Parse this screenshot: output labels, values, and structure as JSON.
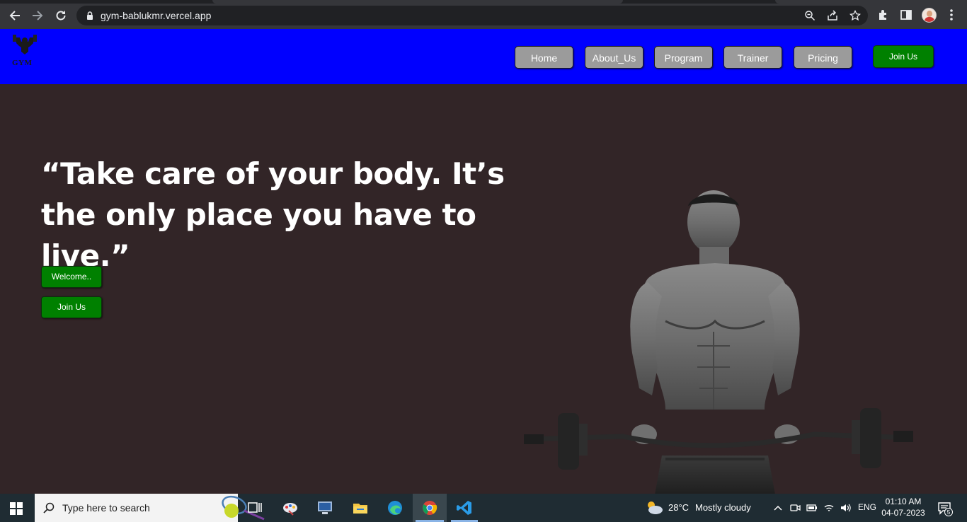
{
  "browser": {
    "url": "gym-bablukmr.vercel.app"
  },
  "site": {
    "logo_text": "GYM",
    "nav": [
      {
        "label": "Home"
      },
      {
        "label": "About_Us"
      },
      {
        "label": "Program"
      },
      {
        "label": "Trainer"
      },
      {
        "label": "Pricing"
      }
    ],
    "nav_join_label": "Join Us"
  },
  "hero": {
    "quote": "“Take care of your body. It’s the only place you have to live.”",
    "welcome_button": "Welcome..",
    "join_button": "Join Us"
  },
  "taskbar": {
    "search_placeholder": "Type here to search",
    "weather_temp": "28°C",
    "weather_desc": "Mostly cloudy",
    "language": "ENG",
    "time": "01:10 AM",
    "date": "04-07-2023",
    "notification_count": "5"
  },
  "colors": {
    "header_bg": "#0000ff",
    "hero_bg": "#322527",
    "button_green": "#008000",
    "nav_pill_gray": "#9b9b9b"
  }
}
